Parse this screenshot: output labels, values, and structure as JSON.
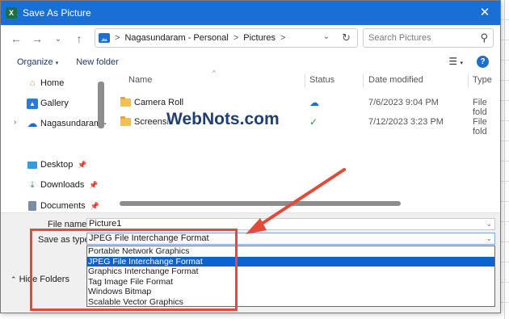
{
  "window": {
    "title": "Save As Picture",
    "app_badge": "X"
  },
  "address": {
    "crumbs": [
      "Nagasundaram - Personal",
      "Pictures"
    ],
    "separator": ">"
  },
  "search": {
    "placeholder": "Search Pictures"
  },
  "commands": {
    "organize": "Organize",
    "new_folder": "New folder",
    "help": "?"
  },
  "nav": {
    "items": [
      {
        "label": "Home",
        "icon": "home-icon"
      },
      {
        "label": "Gallery",
        "icon": "gallery-icon"
      },
      {
        "label": "Nagasundaram -",
        "icon": "cloud-icon"
      },
      {
        "label": "Desktop",
        "icon": "desktop-icon"
      },
      {
        "label": "Downloads",
        "icon": "download-icon"
      },
      {
        "label": "Documents",
        "icon": "document-icon"
      }
    ]
  },
  "columns": [
    "Name",
    "Status",
    "Date modified",
    "Type"
  ],
  "files": [
    {
      "name": "Camera Roll",
      "status_icon": "cloud-outline-icon",
      "date": "7/6/2023 9:04 PM",
      "type": "File fold"
    },
    {
      "name": "Screensh",
      "status_icon": "check-circle-icon",
      "date": "7/12/2023 3:23 PM",
      "type": "File fold"
    }
  ],
  "watermark": "WebNots.com",
  "form": {
    "file_name_label": "File name:",
    "file_name_value": "Picture1",
    "save_type_label": "Save as type:",
    "save_type_value": "JPEG File Interchange Format"
  },
  "type_options": [
    "Portable Network Graphics",
    "JPEG File Interchange Format",
    "Graphics Interchange Format",
    "Tag Image File Format",
    "Windows Bitmap",
    "Scalable Vector Graphics"
  ],
  "selected_option": "JPEG File Interchange Format",
  "hide_folders": "Hide Folders",
  "colors": {
    "titlebar": "#1a6fd4",
    "selection": "#0c62d0",
    "annotation": "#e24b39"
  }
}
